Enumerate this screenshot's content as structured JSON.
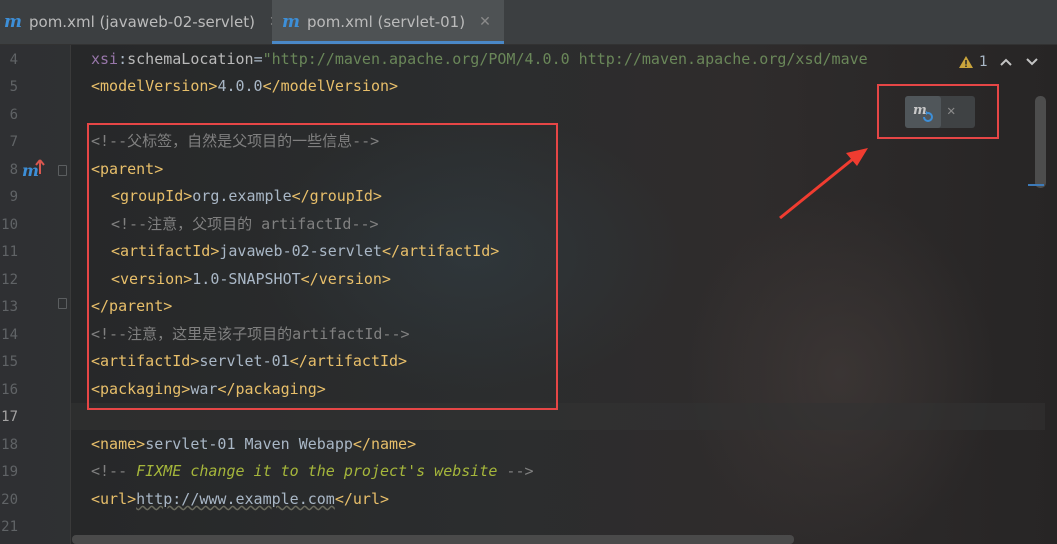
{
  "tabs": [
    {
      "icon": "maven-icon",
      "label": "pom.xml (javaweb-02-servlet)",
      "close": "✕",
      "active": false
    },
    {
      "icon": "maven-icon",
      "label": "pom.xml (servlet-01)",
      "close": "✕",
      "active": true
    }
  ],
  "gutter": {
    "line_numbers": [
      "4",
      "5",
      "6",
      "7",
      "8",
      "9",
      "10",
      "11",
      "12",
      "13",
      "14",
      "15",
      "16",
      "17",
      "18",
      "19",
      "20",
      "21"
    ],
    "current_line": "17",
    "maven_marker_glyph": "m"
  },
  "inspection": {
    "warning_count": "1"
  },
  "maven_reload_popup": {
    "close": "✕"
  },
  "code": {
    "l4": {
      "ns": "xsi",
      "colon": ":",
      "attr": "schemaLocation",
      "eq": "=",
      "value": "\"http://maven.apache.org/POM/4.0.0 http://maven.apache.org/xsd/mave"
    },
    "l5": {
      "open": "<modelVersion>",
      "text": "4.0.0",
      "close": "</modelVersion>"
    },
    "l7": {
      "comment": "<!--父标签，自然是父项目的一些信息-->"
    },
    "l8": {
      "open": "<parent>"
    },
    "l9": {
      "open": "<groupId>",
      "text": "org.example",
      "close": "</groupId>"
    },
    "l10": {
      "comment": "<!--注意，父项目的 artifactId-->"
    },
    "l11": {
      "open": "<artifactId>",
      "text": "javaweb-02-servlet",
      "close": "</artifactId>"
    },
    "l12": {
      "open": "<version>",
      "text": "1.0-SNAPSHOT",
      "close": "</version>"
    },
    "l13": {
      "close": "</parent>"
    },
    "l14": {
      "comment": "<!--注意，这里是该子项目的artifactId-->"
    },
    "l15": {
      "open": "<artifactId>",
      "text": "servlet-01",
      "close": "</artifactId>"
    },
    "l16": {
      "open": "<packaging>",
      "text": "war",
      "close": "</packaging>"
    },
    "l18": {
      "open": "<name>",
      "text": "servlet-01 Maven Webapp",
      "close": "</name>"
    },
    "l19": {
      "comment_open": "<!--",
      "comment_text": " FIXME change it to the project's website ",
      "comment_close": "-->"
    },
    "l20": {
      "open": "<url>",
      "text": "http://www.example.com",
      "close": "</url>"
    }
  },
  "colors": {
    "editor_bg": "#2b2b2b",
    "tag": "#e8bf6a",
    "text": "#a9b7c6",
    "comment": "#808080",
    "string": "#6a8759",
    "namespace": "#9876aa",
    "todo_comment": "#a5b63b",
    "highlight_box": "#e64646",
    "maven_blue": "#3d8fd8"
  }
}
